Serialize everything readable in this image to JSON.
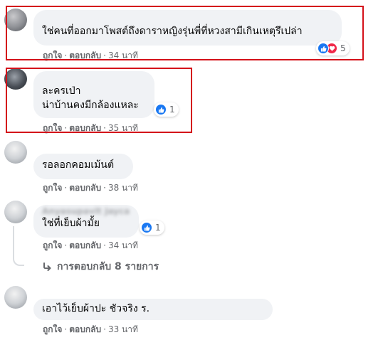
{
  "comments": [
    {
      "author": "",
      "text": "ใช่คนที่ออกมาโพสต์ถึงดาราหญิงรุ่นพี่ที่หวงสามีเกินเหตุรึเปล่า",
      "reaction_count": "5",
      "like": "ถูกใจ",
      "reply": "ตอบกลับ",
      "time": "34 นาที"
    },
    {
      "author": "",
      "text": "ละครเป่า\nน่าบ้านคงมีกล้องแหละ",
      "reaction_count": "1",
      "like": "ถูกใจ",
      "reply": "ตอบกลับ",
      "time": "35 นาที"
    },
    {
      "author": "",
      "text": "รอลอกคอมเม้นต์",
      "like": "ถูกใจ",
      "reply": "ตอบกลับ",
      "time": "38 นาที"
    },
    {
      "author": "Anyasupavit Jaycan",
      "text": "ใช่ที่เย็บผ้ามั้ย",
      "reaction_count": "1",
      "like": "ถูกใจ",
      "reply": "ตอบกลับ",
      "time": "34 นาที"
    },
    {
      "author": "",
      "text": "เอาไว้เย็บผ้าปะ ชัวจริง ร.",
      "like": "ถูกใจ",
      "reply": "ตอบกลับ",
      "time": "33 นาที"
    }
  ],
  "view_replies": "การตอบกลับ 8 รายการ",
  "separator": "·",
  "colors": {
    "highlight": "#d4111a",
    "bubble": "#f0f2f5",
    "meta_text": "#65676b",
    "love": "#f02849",
    "like": "#1877f2"
  },
  "icons": {
    "reaction": "like-love-icons",
    "reply_arrow": "reply-arrow-icon"
  }
}
